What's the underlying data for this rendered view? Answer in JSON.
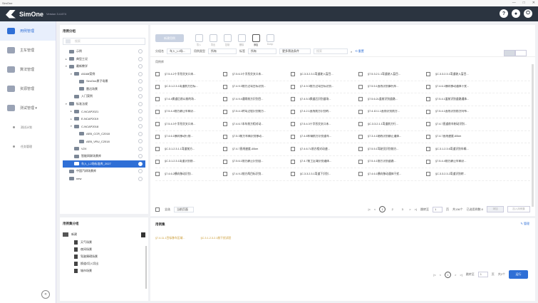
{
  "window": {
    "title": "SimOne",
    "controls": [
      "—",
      "□",
      "✕"
    ]
  },
  "header": {
    "app_name": "SimOne",
    "version": "Version 3.4.674",
    "icons": [
      "help-icon",
      "user-icon",
      "power-icon"
    ]
  },
  "sidebar": {
    "items": [
      {
        "label": "用例管理",
        "active": true
      },
      {
        "label": "主车管理",
        "active": false
      },
      {
        "label": "算法管理",
        "active": false
      },
      {
        "label": "资源管理",
        "active": false
      },
      {
        "label": "测试管理",
        "active": false
      }
    ],
    "subitems": [
      "测试计划",
      "任务管理"
    ],
    "collapse_symbol": "«"
  },
  "tree": {
    "title": "用例分组",
    "search_placeholder": "搜索",
    "nodes": [
      {
        "label": "示例",
        "depth": 0,
        "arrow": ""
      },
      {
        "label": "典型工况",
        "depth": 0,
        "arrow": "▸"
      },
      {
        "label": "最新教学",
        "depth": 0,
        "arrow": "▾"
      },
      {
        "label": "ASAM案例",
        "depth": 1,
        "arrow": "▾"
      },
      {
        "label": "SimOne原子场景",
        "depth": 2,
        "arrow": ""
      },
      {
        "label": "雷达场景",
        "depth": 2,
        "arrow": ""
      },
      {
        "label": "入门案例",
        "depth": 1,
        "arrow": ""
      },
      {
        "label": "标准法规",
        "depth": 0,
        "arrow": "▾"
      },
      {
        "label": "C-NCAP2021",
        "depth": 1,
        "arrow": "▸"
      },
      {
        "label": "E-NCAP2019",
        "depth": 1,
        "arrow": "▸"
      },
      {
        "label": "C-NCAP2018",
        "depth": 1,
        "arrow": "▾"
      },
      {
        "label": "AEB_CCR_C2018",
        "depth": 2,
        "arrow": ""
      },
      {
        "label": "AEB_VRU_C2018",
        "depth": 2,
        "arrow": ""
      },
      {
        "label": "V2X",
        "depth": 1,
        "arrow": ""
      },
      {
        "label": "智能网联场景库",
        "depth": 1,
        "arrow": ""
      },
      {
        "label": "车入_L2场标准库_2027",
        "depth": 1,
        "arrow": "",
        "selected": true
      },
      {
        "label": "中国汽研场景库",
        "depth": 0,
        "arrow": ""
      },
      {
        "label": "new",
        "depth": 0,
        "arrow": ""
      }
    ]
  },
  "categories": {
    "title": "用例集分组",
    "group": "新建",
    "items": [
      "天气场景",
      "夜间场景",
      "驾驶障碍场景",
      "换道/切入切出",
      "城市场景"
    ]
  },
  "toolbar": {
    "new_label": "新建用例",
    "icons": [
      {
        "label": "导入",
        "on": false
      },
      {
        "label": "导出",
        "on": false
      },
      {
        "label": "复制",
        "on": false
      },
      {
        "label": "删除",
        "on": false
      },
      {
        "label": "添加",
        "on": true
      },
      {
        "label": "Dump",
        "on": false
      }
    ]
  },
  "filters": {
    "group_label": "分组名",
    "group_value": "车入_L2场...",
    "type_label": "用例类型",
    "type_value": "所有",
    "tag_label": "标签",
    "tag_value": "所有",
    "more_label": "更多筛选条件",
    "search_placeholder": "搜索",
    "reset_label": "重置"
  },
  "list": {
    "label": "用例库",
    "rows": [
      [
        "§7.5.4.2十字形交叉口未...",
        "§7.5.6.3十字形交叉口未...",
        "§C.3.3.2.3.1弯道驶入盲目...",
        "§7.5.3.2.1.1弯道驶入盲目...",
        "§C.3.3.2.3.1弯道驶入盲目..."
      ],
      [
        "§C.3.1.2.3.1弯道前方目标...",
        "§7.4.9.3前方过弯目标识别...",
        "§7.4.9.3前方过弯目标识别...",
        "§7.5.5.1直线识别摩托车...",
        "§7.4.6.1横向移动通体干扰..."
      ],
      [
        "§7.4.4换道后前以前的场...",
        "§7.4.9.4通常前方识别目...",
        "§7.4.5.3换道后识别道场...",
        "§7.5.6.2L盖前识别道路...",
        "§7.5.4.1盖前识别道路通体..."
      ],
      [
        "§7.5.4.4前方静止车辆识...",
        "§7.5.4.1转弯过程识别前方...",
        "§7.4.2.1直线前方识别的...",
        "§7.4.10.1.1直线识别前方...",
        "§7.5.4.1直线识别前方阿布..."
      ],
      [
        "§7.5.4.3十字形交叉口未...",
        "§7.4.6.7本车前方相对动...",
        "§7.5.4.3十字形交叉口未...",
        "§C.3.3.2.1.1弯道前方行...",
        "§7.4.7直道前车制动识别..."
      ],
      [
        "§7.4.6.1横向移动行前...",
        "§7.5.3前方车辆识别移动...",
        "§7.4.8车辆前方识别道车...",
        "§7.3.4.1轴线识别静止通体...",
        "§7.4.7直线速度-60km"
      ],
      [
        "§C.3.1.2.3.1.1弯道前方...",
        "§7.4.7直线速度-40km",
        "§7.4.6.7L前方相对动速...",
        "§7.5.5.1驾驶员识别前方...",
        "§C.3.1.2.3.6弯道识别车辆..."
      ],
      [
        "§C.3.1.2.3.1弯道识别前...",
        "§7.5.6.1前方静止识别自...",
        "§7.4.7前工区域识别通体...",
        "§7.5.4.1前方识别道路...",
        "§7.5.4.4前方静止车辆识..."
      ],
      [
        "§7.4.6.2横向移动识别...",
        "§7.4.9.2前方两目标识别...",
        "§C.3.3.2.3.1弯道下识别...",
        "§7.4.6.1横向移动通体干扰...",
        "§C.3.3.2.3.2弯道识别转..."
      ]
    ]
  },
  "pager": {
    "select_all": "全选",
    "current_page_select": "当前页面",
    "pages": [
      "1",
      "2",
      "3"
    ],
    "current": "1",
    "goto_label": "跳转至",
    "goto_value": "1",
    "page_suffix": "页",
    "total_label": "共136个",
    "selected_label": "已选用例数:0",
    "add_label": "添加",
    "add_to_set_label": "加入用例集"
  },
  "selected": {
    "title": "用例集",
    "manage_label": "管理",
    "items": [
      "§7.4.11.1目标移车区域...",
      "§C.3.1.2.3.2.1前干扰试验"
    ],
    "goto_label": "跳转至",
    "goto_value": "1",
    "page_suffix": "页",
    "total_label": "共2个",
    "run_label": "运行",
    "page": "1"
  }
}
